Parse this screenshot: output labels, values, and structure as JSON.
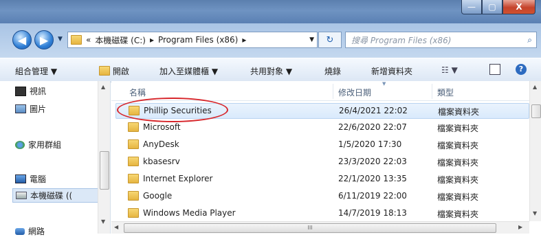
{
  "window": {
    "minimize": "—",
    "maximize": "▢",
    "close": "X"
  },
  "nav": {
    "back": "◀",
    "forward": "▶",
    "dropdown": "▼"
  },
  "address": {
    "overflow": "«",
    "crumbs": [
      "本機磁碟 (C:)",
      "Program Files (x86)"
    ],
    "sep": "▸"
  },
  "search": {
    "placeholder": "搜尋 Program Files (x86)"
  },
  "toolbar": {
    "organize": "組合管理 ▼",
    "open": "開啟",
    "include": "加入至媒體櫃 ▼",
    "share": "共用對象 ▼",
    "burn": "燒錄",
    "newfolder": "新增資料夾"
  },
  "sidebar": {
    "items": [
      {
        "label": "視訊"
      },
      {
        "label": "圖片"
      },
      {
        "label": "家用群組"
      },
      {
        "label": "電腦"
      },
      {
        "label": "本機磁碟 (("
      },
      {
        "label": "網路"
      }
    ]
  },
  "columns": {
    "name": "名稱",
    "date": "修改日期",
    "type": "類型"
  },
  "files": [
    {
      "name": "Phillip Securities",
      "date": "26/4/2021 22:02",
      "type": "檔案資料夾"
    },
    {
      "name": "Microsoft",
      "date": "22/6/2020 22:07",
      "type": "檔案資料夾"
    },
    {
      "name": "AnyDesk",
      "date": "1/5/2020 17:30",
      "type": "檔案資料夾"
    },
    {
      "name": "kbasesrv",
      "date": "23/3/2020 22:03",
      "type": "檔案資料夾"
    },
    {
      "name": "Internet Explorer",
      "date": "22/1/2020 13:35",
      "type": "檔案資料夾"
    },
    {
      "name": "Google",
      "date": "6/11/2019 22:00",
      "type": "檔案資料夾"
    },
    {
      "name": "Windows Media Player",
      "date": "14/7/2019 18:13",
      "type": "檔案資料夾"
    }
  ],
  "colors": {
    "highlight": "#d7262b",
    "selection": "#d9eafc"
  }
}
